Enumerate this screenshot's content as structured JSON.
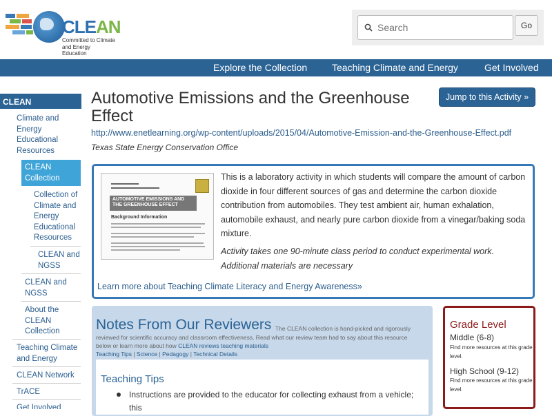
{
  "header": {
    "logo": {
      "word_a": "CLE",
      "word_b": "AN",
      "tagline_1": "Committed to Climate",
      "tagline_2": "and Energy Education"
    },
    "search": {
      "placeholder": "Search",
      "button_label": "Go"
    },
    "nav": [
      "Explore the Collection",
      "Teaching Climate and Energy",
      "Get Involved"
    ]
  },
  "sidebar": {
    "title": "CLEAN",
    "items": [
      "Climate and Energy Educational Resources",
      "CLEAN Collection",
      "Collection of Climate and Energy Educational Resources",
      "CLEAN and NGSS",
      "CLEAN and NGSS",
      "About the CLEAN Collection",
      "Teaching Climate and Energy",
      "CLEAN Network",
      "TrACE",
      "Get Involved"
    ]
  },
  "resource": {
    "title": "Automotive Emissions and the Greenhouse Effect",
    "url": "http://www.enetlearning.org/wp-content/uploads/2015/04/Automotive-Emission-and-the-Greenhouse-Effect.pdf",
    "source": "Texas State Energy Conservation Office",
    "jump_label": "Jump to this Activity »",
    "thumbnail_heading": "AUTOMOTIVE EMISSIONS AND THE GREENHOUSE EFFECT",
    "thumbnail_subheading": "Background Information",
    "summary": "This is a laboratory activity in which students will compare the amount of carbon dioxide in four different sources of gas and determine the carbon dioxide contribution from automobiles. They test ambient air, human exhalation, automobile exhaust, and nearly pure carbon dioxide from a vinegar/baking soda mixture.",
    "note": "Activity takes one 90-minute class period to conduct experimental work. Additional materials are necessary",
    "learn_more": "Learn more about Teaching Climate Literacy and Energy Awareness»"
  },
  "notes": {
    "title": "Notes From Our Reviewers",
    "intro": "The CLEAN collection is hand-picked and rigorously reviewed for scientific accuracy and classroom effectiveness. Read what our review team had to say about this resource below or learn more about how",
    "intro_link": "CLEAN reviews teaching materials",
    "tabs": [
      "Teaching Tips",
      "Science",
      "Pedagogy",
      "Technical Details"
    ],
    "tab_separator": " | ",
    "tips_title": "Teaching Tips",
    "tip_1": "Instructions are provided to the educator for collecting exhaust from a vehicle; this"
  },
  "grade": {
    "title": "Grade Level",
    "levels": [
      {
        "name": "Middle (6-8)",
        "more": "Find more resources at this grade level."
      },
      {
        "name": "High School (9-12)",
        "more": "Find more resources at this grade level."
      }
    ]
  },
  "colors": {
    "brand_blue": "#2b6395",
    "active_blue": "#3fa4d8",
    "grade_red": "#8b1a1a",
    "notes_bg": "#c6d8ea"
  }
}
